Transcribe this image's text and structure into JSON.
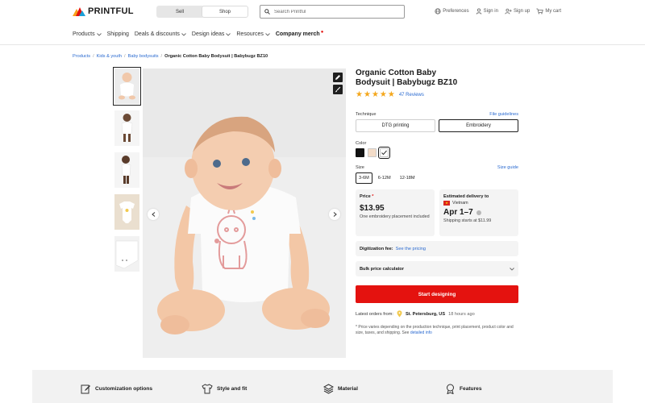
{
  "brand": {
    "logo_text": "PRINTFUL",
    "colors": {
      "accent": "#e4120f",
      "link": "#2a6ad0",
      "star": "#f4a71c"
    }
  },
  "header": {
    "toggle": [
      {
        "label": "Sell"
      },
      {
        "label": "Shop"
      }
    ],
    "search_placeholder": "Search Printful",
    "links": [
      {
        "label": "Preferences",
        "icon": "globe-icon"
      },
      {
        "label": "Sign in",
        "icon": "user-icon"
      },
      {
        "label": "Sign up",
        "icon": "user-plus-icon"
      },
      {
        "label": "My cart",
        "icon": "cart-icon"
      }
    ]
  },
  "nav": {
    "items": [
      {
        "label": "Products",
        "dropdown": true
      },
      {
        "label": "Shipping",
        "dropdown": false
      },
      {
        "label": "Deals & discounts",
        "dropdown": true
      },
      {
        "label": "Design ideas",
        "dropdown": true
      },
      {
        "label": "Resources",
        "dropdown": true
      },
      {
        "label": "Company merch",
        "dropdown": false
      }
    ]
  },
  "breadcrumb": [
    "Products",
    "Kids & youth",
    "Baby bodysuits",
    "Organic Cotton Baby Bodysuit | Babybugz BZ10"
  ],
  "product": {
    "title": "Organic Cotton Baby Bodysuit | Babybugz BZ10",
    "rating": 5,
    "reviews": "47 Reviews",
    "technique_label": "Technique",
    "file_guidelines": "File guidelines",
    "techniques": [
      "DTG printing",
      "Embroidery"
    ],
    "selected_technique": "Embroidery",
    "color_label": "Color",
    "colors": [
      "#111111",
      "#f3dcc8",
      "#ffffff"
    ],
    "size_label": "Size",
    "size_guide": "Size guide",
    "sizes": [
      "3-6M",
      "6-12M",
      "12-18M"
    ],
    "selected_size": "3-6M",
    "price_label": "Price",
    "price": "$13.95",
    "price_note": "One embroidery placement included",
    "delivery_label": "Estimated delivery to",
    "delivery_country": "Vietnam",
    "delivery_dates": "Apr 1–7",
    "shipping_note": "Shipping starts at $11.99",
    "digitization_label": "Digitization fee:",
    "digitization_link": "See the pricing",
    "bulk_label": "Bulk price calculator",
    "cta": "Start designing",
    "latest_label": "Latest orders from:",
    "latest_location": "St. Petersburg, US",
    "latest_time": "18 hours ago",
    "note": "* Price varies depending on the production technique, print placement, product color and size, taxes, and shipping. See",
    "note_link": "detailed info"
  },
  "features": [
    {
      "label": "Customization options",
      "icon": "edit-icon"
    },
    {
      "label": "Style and fit",
      "icon": "shirt-icon"
    },
    {
      "label": "Material",
      "icon": "layers-icon"
    },
    {
      "label": "Features",
      "icon": "badge-icon"
    }
  ]
}
